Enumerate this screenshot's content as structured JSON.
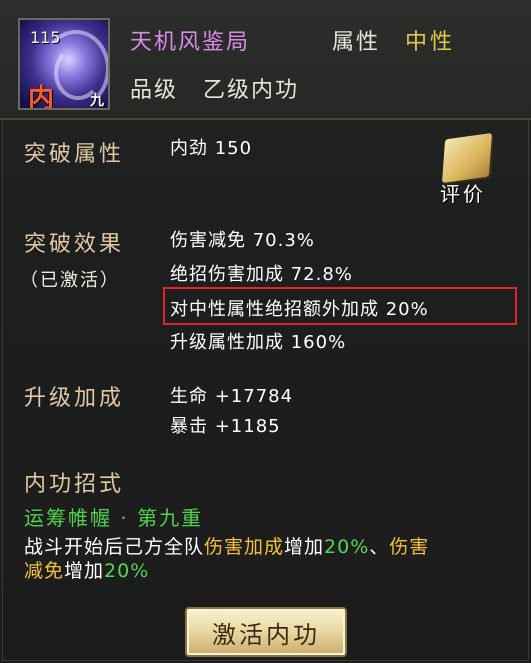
{
  "header": {
    "level": "115",
    "type_badge": "内",
    "tier_badge": "九",
    "skill_name": "天机风鉴局",
    "attribute_label": "属性",
    "attribute_value": "中性",
    "grade_label": "品级",
    "grade_value": "乙级内功"
  },
  "evaluate": {
    "label": "评价"
  },
  "breakthrough_attr": {
    "title": "突破属性",
    "line": "内劲  150"
  },
  "breakthrough_effect": {
    "title": "突破效果",
    "status": "（已激活）",
    "lines": [
      "伤害减免  70.3%",
      "绝招伤害加成  72.8%",
      "对中性属性绝招额外加成  20%",
      "升级属性加成  160%"
    ]
  },
  "upgrade_bonus": {
    "title": "升级加成",
    "lines": [
      "生命  +17784",
      "暴击  +1185"
    ]
  },
  "moves": {
    "title": "内功招式",
    "move_name": "运筹帷幄 · 第九重",
    "desc_line1_a": "战斗开始后己方全队",
    "desc_line1_b": "伤害加成",
    "desc_line1_c": "增加",
    "desc_line1_d": "20%",
    "desc_line1_e": "、",
    "desc_line1_f": "伤害",
    "desc_line2_a": "减免",
    "desc_line2_b": "增加",
    "desc_line2_c": "20%"
  },
  "activate_button": {
    "label": "激活内功"
  },
  "colors": {
    "skill_name": "#d98de6",
    "attribute_value": "#e3c94a",
    "section_title": "#e2c9a6",
    "move_name": "#4fd34d",
    "highlight_gold": "#f3c23c",
    "highlight_green": "#5ad35a",
    "highlight_box": "#e0262a"
  },
  "icons": [
    "skill-icon",
    "evaluate-scroll-icon"
  ]
}
